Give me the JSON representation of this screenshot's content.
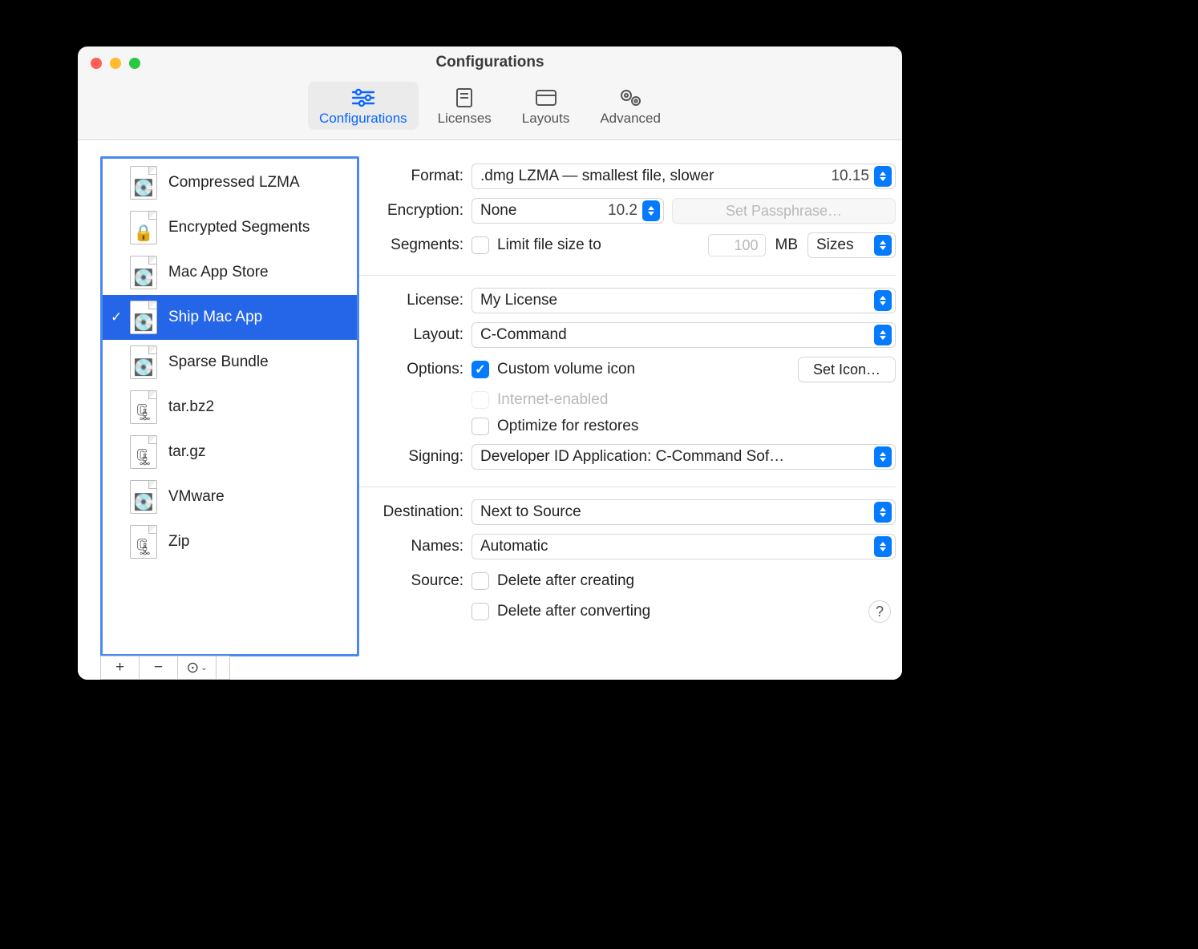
{
  "window": {
    "title": "Configurations"
  },
  "toolbar": {
    "items": [
      {
        "label": "Configurations",
        "icon": "sliders",
        "selected": true
      },
      {
        "label": "Licenses",
        "icon": "license"
      },
      {
        "label": "Layouts",
        "icon": "window"
      },
      {
        "label": "Advanced",
        "icon": "gears"
      }
    ]
  },
  "sidebar": {
    "items": [
      {
        "label": "Compressed LZMA",
        "glyph": "💽"
      },
      {
        "label": "Encrypted Segments",
        "glyph": "🔒"
      },
      {
        "label": "Mac App Store",
        "glyph": "💽"
      },
      {
        "label": "Ship Mac App",
        "glyph": "💽",
        "selected": true,
        "checked": true
      },
      {
        "label": "Sparse Bundle",
        "glyph": "💽"
      },
      {
        "label": "tar.bz2",
        "glyph": "🗜"
      },
      {
        "label": "tar.gz",
        "glyph": "🗜"
      },
      {
        "label": "VMware",
        "glyph": "💽"
      },
      {
        "label": "Zip",
        "glyph": "🗜"
      }
    ],
    "footer": {
      "add": "+",
      "remove": "−",
      "more": "⊙"
    }
  },
  "labels": {
    "format": "Format:",
    "encryption": "Encryption:",
    "segments": "Segments:",
    "license": "License:",
    "layout": "Layout:",
    "options": "Options:",
    "signing": "Signing:",
    "destination": "Destination:",
    "names": "Names:",
    "source": "Source:"
  },
  "format": {
    "value": ".dmg LZMA — smallest file, slower",
    "os_version": "10.15"
  },
  "encryption": {
    "value": "None",
    "os_version": "10.2",
    "set_passphrase_label": "Set Passphrase…"
  },
  "segments": {
    "limit_label": "Limit file size to",
    "limit_checked": false,
    "size_value": "100",
    "unit": "MB",
    "sizes_label": "Sizes"
  },
  "license": {
    "value": "My License"
  },
  "layout": {
    "value": "C-Command"
  },
  "options": {
    "custom_volume_icon": {
      "label": "Custom volume icon",
      "checked": true
    },
    "set_icon_label": "Set Icon…",
    "internet_enabled": {
      "label": "Internet-enabled",
      "disabled": true
    },
    "optimize_restores": {
      "label": "Optimize for restores",
      "checked": false
    }
  },
  "signing": {
    "value": "Developer ID Application: C-Command Sof…"
  },
  "destination": {
    "value": "Next to Source"
  },
  "names": {
    "value": "Automatic"
  },
  "source": {
    "delete_after_creating": {
      "label": "Delete after creating",
      "checked": false
    },
    "delete_after_converting": {
      "label": "Delete after converting",
      "checked": false
    }
  },
  "help": "?"
}
